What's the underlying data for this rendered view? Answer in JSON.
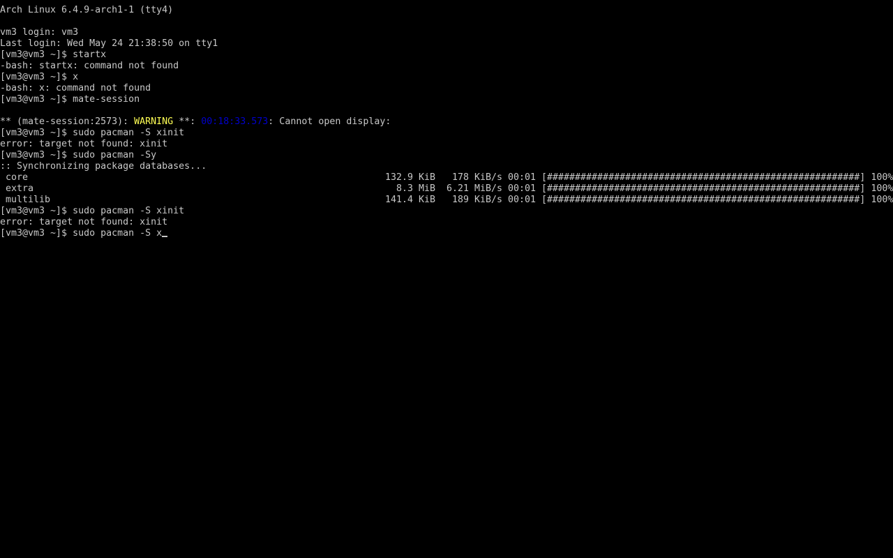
{
  "console": {
    "lines": [
      {
        "type": "text",
        "text": "Arch Linux 6.4.9-arch1-1 (tty4)"
      },
      {
        "type": "blank"
      },
      {
        "type": "text",
        "text": "vm3 login: vm3"
      },
      {
        "type": "text",
        "text": "Last login: Wed May 24 21:38:50 on tty1"
      },
      {
        "type": "text",
        "text": "[vm3@vm3 ~]$ startx"
      },
      {
        "type": "text",
        "text": "-bash: startx: command not found"
      },
      {
        "type": "text",
        "text": "[vm3@vm3 ~]$ x"
      },
      {
        "type": "text",
        "text": "-bash: x: command not found"
      },
      {
        "type": "text",
        "text": "[vm3@vm3 ~]$ mate-session"
      },
      {
        "type": "blank"
      },
      {
        "type": "warning",
        "prefix": "** (mate-session:2573): ",
        "level": "WARNING",
        "mid": " **: ",
        "stamp": "00:18:33.573",
        "message": ": Cannot open display:"
      },
      {
        "type": "text",
        "text": "[vm3@vm3 ~]$ sudo pacman -S xinit"
      },
      {
        "type": "text",
        "text": "error: target not found: xinit"
      },
      {
        "type": "text",
        "text": "[vm3@vm3 ~]$ sudo pacman -Sy"
      },
      {
        "type": "text",
        "text": ":: Synchronizing package databases..."
      },
      {
        "type": "progress",
        "name": "core",
        "size": "132.9 KiB",
        "rate": "178 KiB/s",
        "time": "00:01",
        "bar": "[########################################################]",
        "percent": "100%"
      },
      {
        "type": "progress",
        "name": "extra",
        "size": "8.3 MiB",
        "rate": "6.21 MiB/s",
        "time": "00:01",
        "bar": "[########################################################]",
        "percent": "100%"
      },
      {
        "type": "progress",
        "name": "multilib",
        "size": "141.4 KiB",
        "rate": "189 KiB/s",
        "time": "00:01",
        "bar": "[########################################################]",
        "percent": "100%"
      },
      {
        "type": "text",
        "text": "[vm3@vm3 ~]$ sudo pacman -S xinit"
      },
      {
        "type": "text",
        "text": "error: target not found: xinit"
      },
      {
        "type": "prompt",
        "text": "[vm3@vm3 ~]$ sudo pacman -S x"
      }
    ]
  },
  "colors": {
    "background": "#000000",
    "foreground": "#c8c8c8",
    "warning": "#ffff55",
    "timestamp": "#0000cc"
  }
}
